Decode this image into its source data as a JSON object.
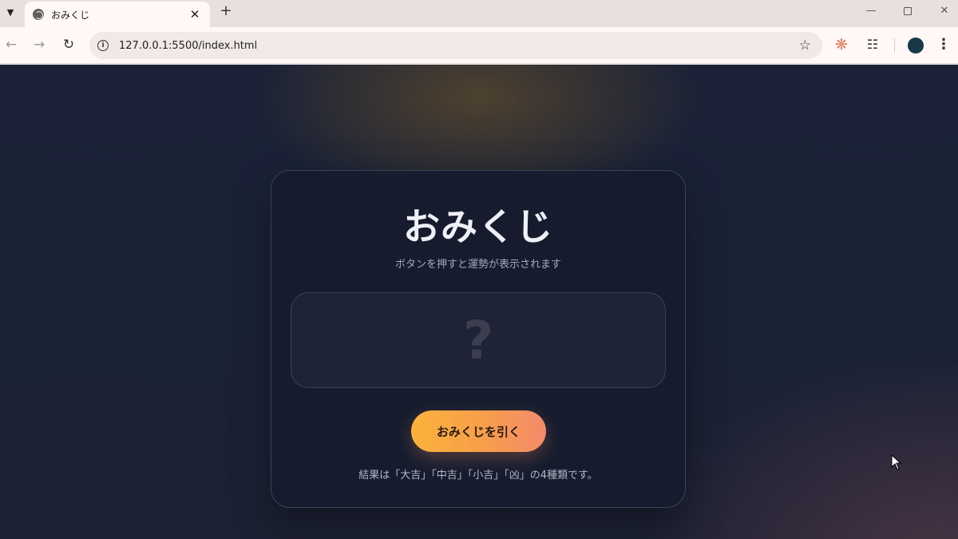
{
  "browser": {
    "tab": {
      "title": "おみくじ"
    },
    "address_bar": {
      "url": "127.0.0.1:5500/index.html"
    }
  },
  "page": {
    "title": "おみくじ",
    "subtitle": "ボタンを押すと運勢が表示されます",
    "result": {
      "placeholder": "?"
    },
    "draw_button": {
      "label": "おみくじを引く"
    },
    "note": "結果は「大吉」「中吉」「小吉」「凶」の4種類です。"
  },
  "colors": {
    "background": "#1b2237",
    "card_border": "#39425a",
    "button_start": "#fbb23a",
    "button_end": "#f48a6a",
    "extension_icon": "#e3805c",
    "avatar": "#17394a"
  },
  "icons": {
    "tab_search": "chevron-down-icon",
    "favicon": "globe-icon",
    "back": "arrow-left-icon",
    "forward": "arrow-right-icon",
    "reload": "reload-icon",
    "site_info": "info-icon",
    "bookmark": "star-icon",
    "extension": "sun-icon",
    "extensions_menu": "puzzle-icon",
    "menu": "more-vertical-icon"
  }
}
